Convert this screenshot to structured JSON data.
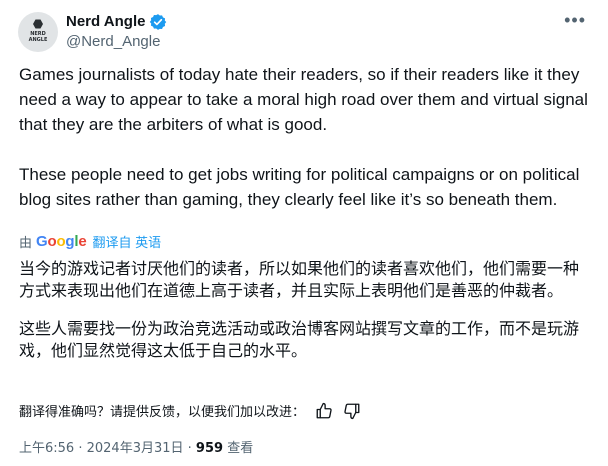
{
  "author": {
    "display_name": "Nerd Angle",
    "handle": "@Nerd_Angle",
    "avatar_text": "NERD ANGLE",
    "verified": true
  },
  "tweet": {
    "paragraphs": [
      "Games journalists of today hate their readers, so if their readers like it they need a way to appear to take a moral high road over them and virtual signal that they are the arbiters of what is good.",
      "These people need to get jobs writing for political campaigns or on political blog sites rather than gaming, they clearly feel like it’s so beneath them."
    ]
  },
  "translation_bar": {
    "by_label": "由",
    "provider": "Google",
    "action_label": "翻译自 英语"
  },
  "translation": {
    "paragraphs": [
      "当今的游戏记者讨厌他们的读者，所以如果他们的读者喜欢他们，他们需要一种方式来表现出他们在道德上高于读者，并且实际上表明他们是善恶的仲裁者。",
      "这些人需要找一份为政治竞选活动或政治博客网站撰写文章的工作，而不是玩游戏，他们显然觉得这太低于自己的水平。"
    ]
  },
  "feedback": {
    "prompt": "翻译得准确吗？请提供反馈，以便我们加以改进：",
    "like_icon": "thumbs-up-icon",
    "dislike_icon": "thumbs-down-icon"
  },
  "meta": {
    "time": "上午6:56",
    "separator": " · ",
    "date": "2024年3月31日",
    "views_count": "959",
    "views_label": " 查看"
  },
  "colors": {
    "accent": "#1d9bf0",
    "secondary_text": "#536471",
    "primary_text": "#0f1419"
  }
}
